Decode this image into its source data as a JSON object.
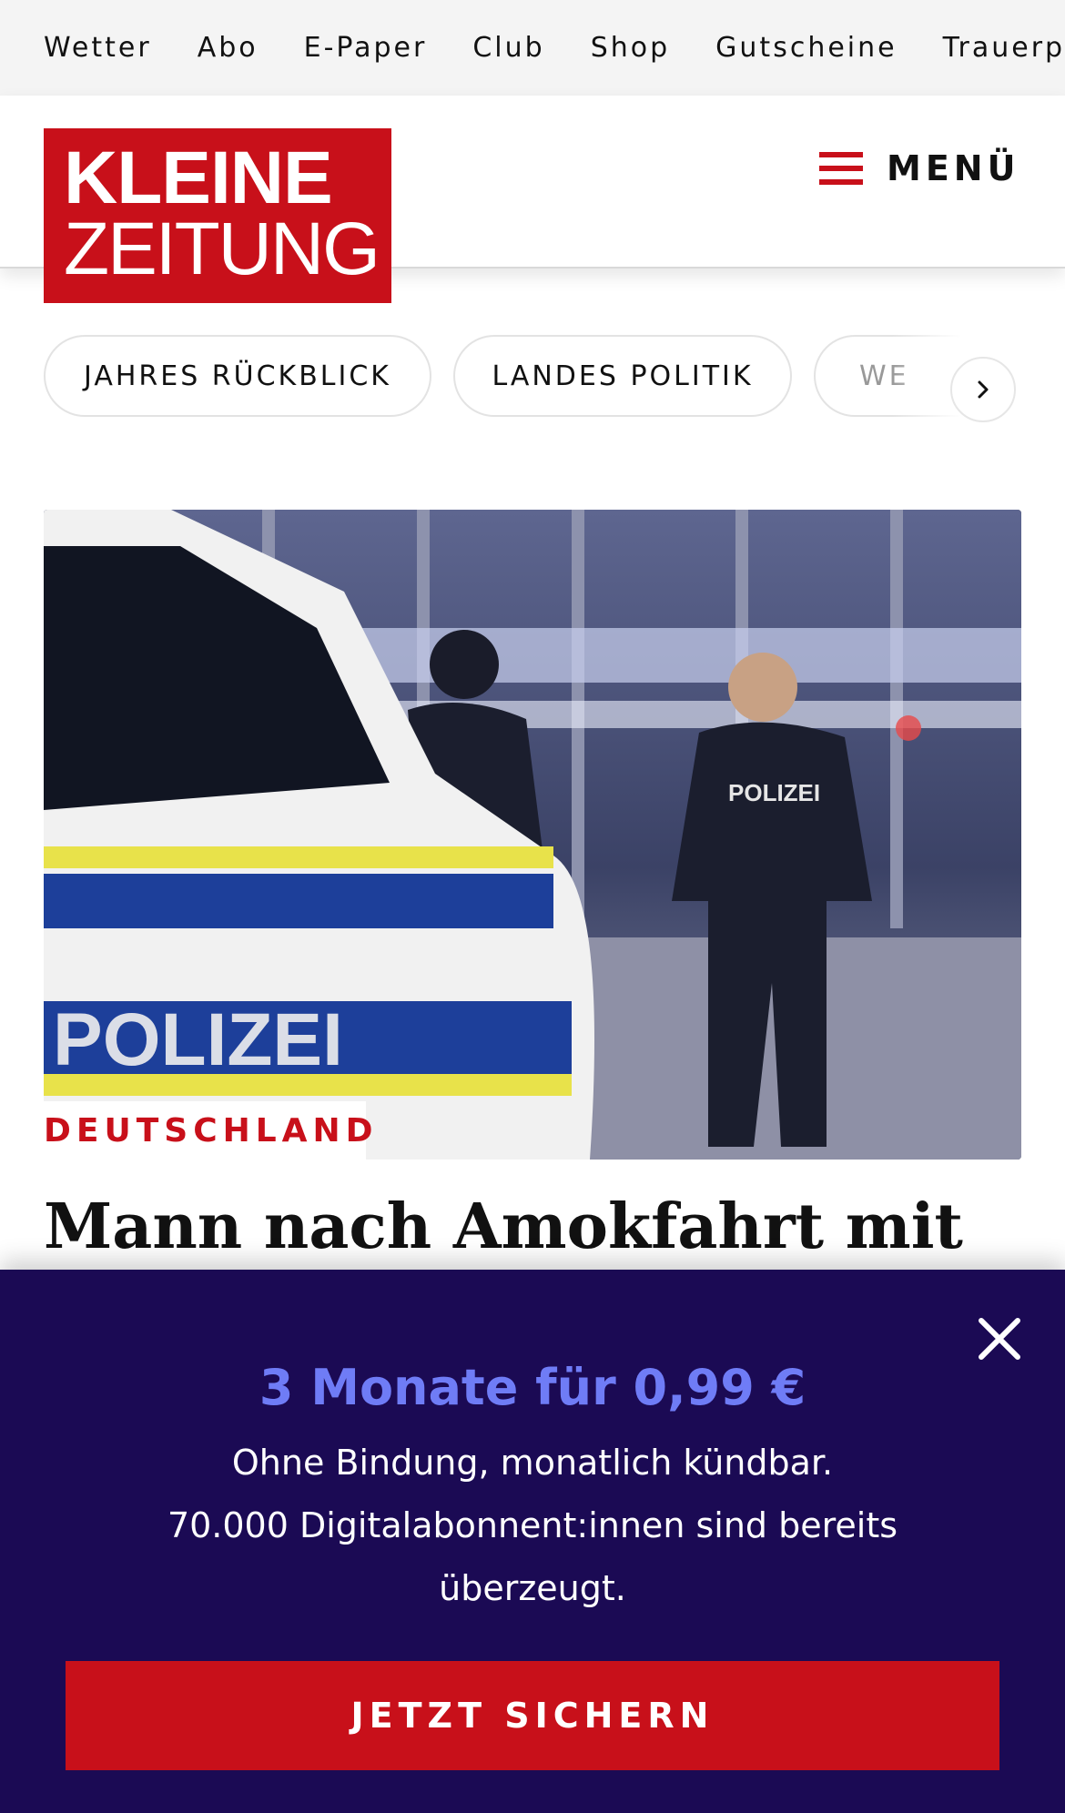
{
  "top_nav": {
    "items": [
      "Wetter",
      "Abo",
      "E-Paper",
      "Club",
      "Shop",
      "Gutscheine",
      "Trauerpo"
    ]
  },
  "header": {
    "logo_line1": "KLEINE",
    "logo_line2": "ZEITUNG",
    "menu_label": "MENÜ",
    "brand_color": "#c8101a"
  },
  "chips": {
    "items": [
      "JAHRES RÜCKBLICK",
      "LANDES POLITIK",
      "WE"
    ],
    "next_icon": "chevron-right-icon"
  },
  "article": {
    "kicker": "DEUTSCHLAND",
    "headline": "Mann nach Amokfahrt mit"
  },
  "paywall": {
    "title": "3 Monate für 0,99 €",
    "line1": "Ohne Bindung, monatlich kündbar.",
    "line2": "70.000 Digitalabonnent:innen sind bereits überzeugt.",
    "cta_label": "JETZT SICHERN",
    "close_icon": "close-icon",
    "background_color": "#1b0a54",
    "title_color": "#6f7cf6"
  }
}
